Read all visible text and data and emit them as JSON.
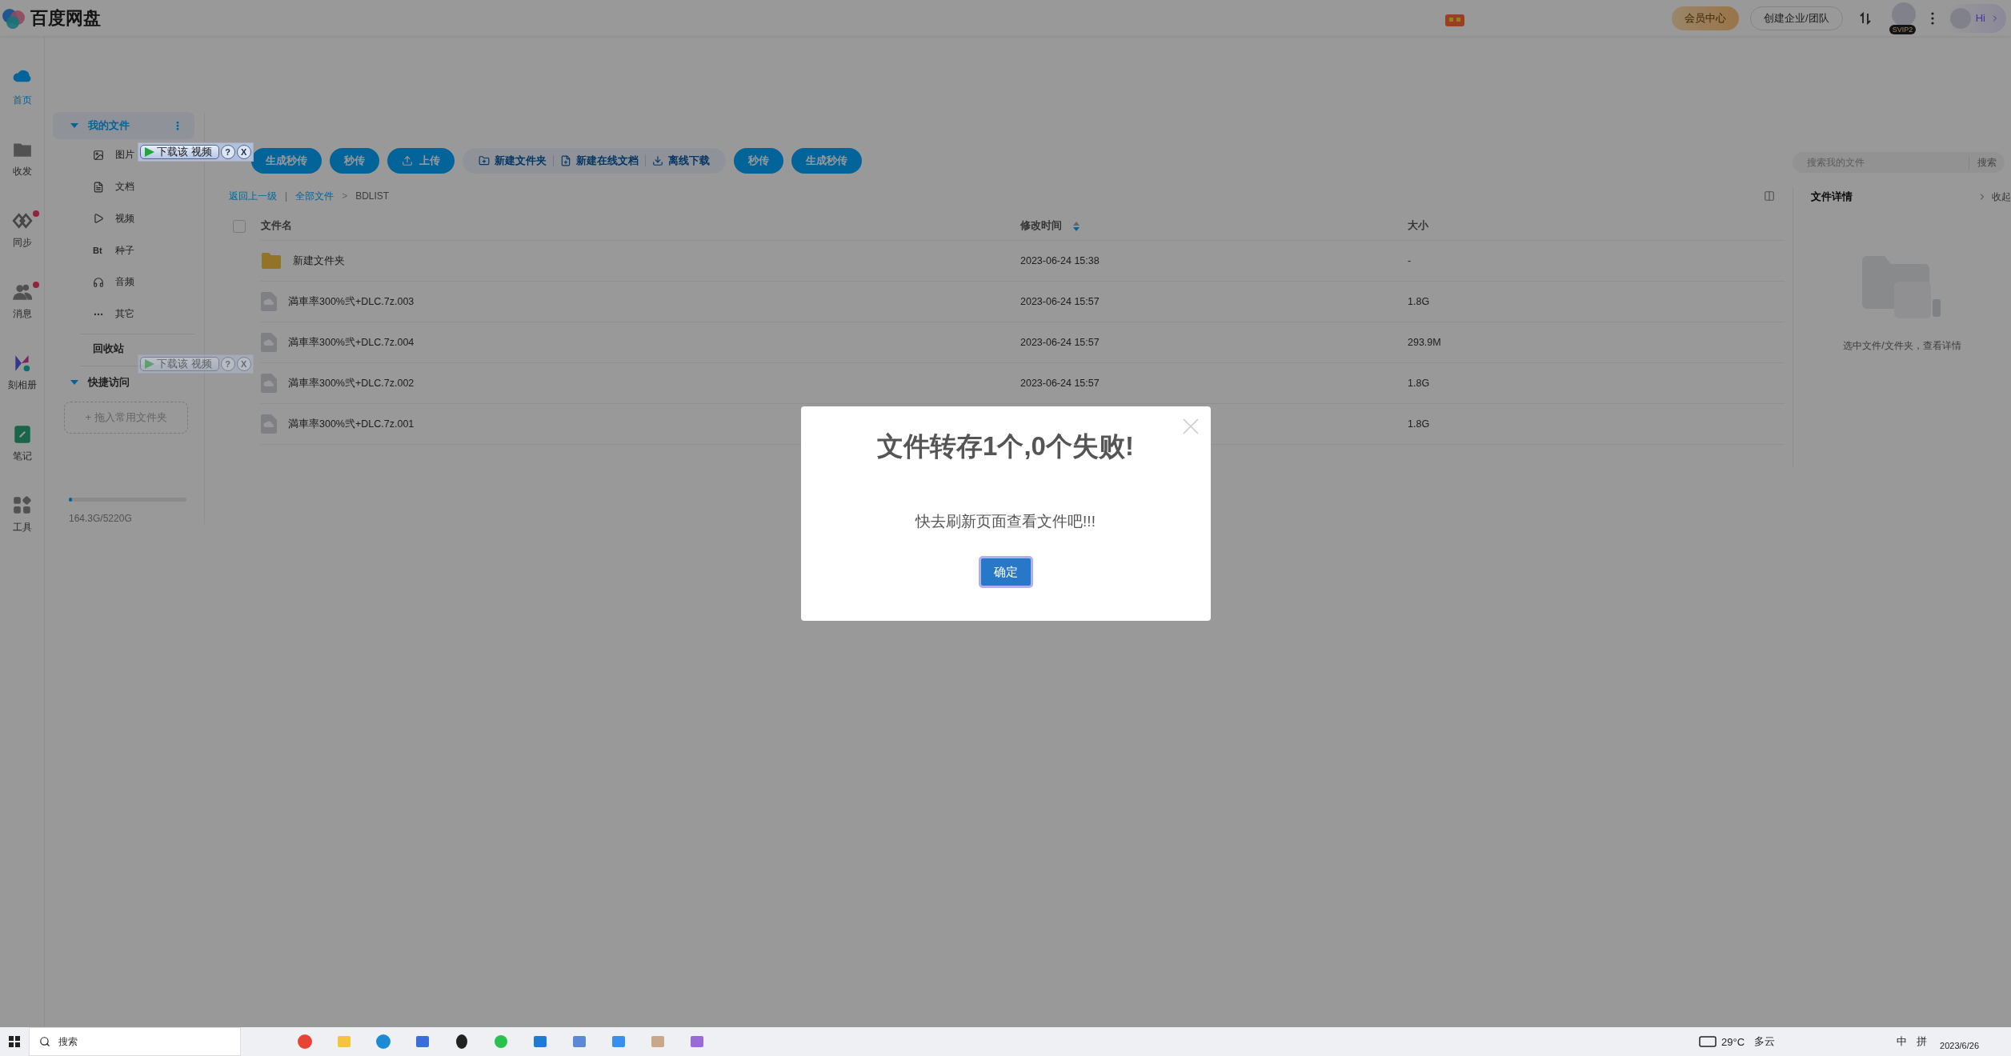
{
  "header": {
    "logo": "百度网盘",
    "buttons": [
      {
        "label": "会员中心",
        "kind": "vip"
      },
      {
        "label": "创建企业/团队",
        "kind": "plain"
      }
    ],
    "badge": "SVIP2",
    "greeting": "Hi"
  },
  "nav": [
    {
      "label": "首页",
      "kind": "cloud",
      "selected": true,
      "dot": false
    },
    {
      "label": "收发",
      "kind": "share",
      "selected": false,
      "dot": false
    },
    {
      "label": "同步",
      "kind": "sync",
      "selected": false,
      "dot": true
    },
    {
      "label": "消息",
      "kind": "people",
      "selected": false,
      "dot": true
    },
    {
      "label": "刻相册",
      "kind": "album",
      "selected": false,
      "dot": false
    },
    {
      "label": "笔记",
      "kind": "note",
      "selected": false,
      "dot": false
    },
    {
      "label": "工具",
      "kind": "tools",
      "selected": false,
      "dot": false
    }
  ],
  "sidebar": {
    "section": {
      "label": "我的文件",
      "expanded": true,
      "selected": true,
      "menu": "⋮"
    },
    "items": [
      {
        "label": "图片",
        "kind": "image"
      },
      {
        "label": "文档",
        "kind": "doc"
      },
      {
        "label": "视频",
        "kind": "video"
      },
      {
        "label": "种子",
        "kind": "glyph",
        "glyph": "Bt"
      },
      {
        "label": "音频",
        "kind": "audio"
      },
      {
        "label": "其它",
        "kind": "more"
      }
    ],
    "recycle": "回收站",
    "quick": {
      "label": "快捷访问",
      "expanded": true,
      "hint": "+ 拖入常用文件夹"
    },
    "storage": {
      "level": 0.03,
      "text": "164.3G/5220G"
    }
  },
  "toolbar": [
    {
      "kind": "primary",
      "label": "生成秒传"
    },
    {
      "kind": "primary",
      "label": "秒传"
    },
    {
      "kind": "upload",
      "label": "上传"
    },
    {
      "kind": "group",
      "items": [
        {
          "label": "新建文件夹",
          "kind": "folder"
        },
        {
          "label": "新建在线文档",
          "kind": "doc"
        },
        {
          "label": "离线下载",
          "kind": "download"
        }
      ]
    },
    {
      "kind": "primary",
      "label": "秒传"
    },
    {
      "kind": "primary",
      "label": "生成秒传"
    }
  ],
  "breadcrumb": {
    "back": "返回上一级",
    "separator": "|",
    "links": [
      "全部文件"
    ],
    "arrow": ">",
    "current": "BDLIST"
  },
  "table": {
    "select_all": {
      "checked": false
    },
    "columns": [
      {
        "label": "文件名",
        "sorted": false
      },
      {
        "label": "修改时间",
        "sorted": true
      },
      {
        "label": "大小",
        "sorted": false
      }
    ],
    "rows": [
      {
        "kind": "folder",
        "name": "新建文件夹",
        "time": "2023-06-24 15:38",
        "size": "-"
      },
      {
        "kind": "file",
        "name": "満車率300%弐+DLC.7z.003",
        "time": "2023-06-24 15:57",
        "size": "1.8G"
      },
      {
        "kind": "file",
        "name": "満車率300%弐+DLC.7z.004",
        "time": "2023-06-24 15:57",
        "size": "293.9M"
      },
      {
        "kind": "file",
        "name": "満車率300%弐+DLC.7z.002",
        "time": "2023-06-24 15:57",
        "size": "1.8G"
      },
      {
        "kind": "file",
        "name": "満車率300%弐+DLC.7z.001",
        "size": "1.8G"
      }
    ]
  },
  "details": {
    "search_placeholder": "搜索我的文件",
    "search_button": "搜索",
    "title": "文件详情",
    "collapse": "收起",
    "empty": "选中文件/文件夹，查看详情"
  },
  "extension_widgets": [
    {
      "label": "下载该 视频",
      "help": "?",
      "close": "X",
      "faded": false
    },
    {
      "label": "下载该 视频",
      "help": "?",
      "close": "X",
      "faded": true
    }
  ],
  "dialog": {
    "title": "文件转存1个,0个失败!",
    "message": "快去刷新页面查看文件吧!!!",
    "button": "确定"
  },
  "taskbar": {
    "search": "搜索",
    "apps": [
      {
        "kind": "chrome"
      },
      {
        "kind": "folder"
      },
      {
        "kind": "edge"
      },
      {
        "kind": "store"
      },
      {
        "kind": "penguin"
      },
      {
        "kind": "chat"
      },
      {
        "kind": "mail"
      },
      {
        "kind": "window"
      },
      {
        "kind": "bird"
      },
      {
        "kind": "figure"
      },
      {
        "kind": "note"
      }
    ],
    "temperature": "29°C",
    "weather": "多云",
    "ime": "中",
    "ime2": "拼",
    "date": "2023/6/26"
  }
}
